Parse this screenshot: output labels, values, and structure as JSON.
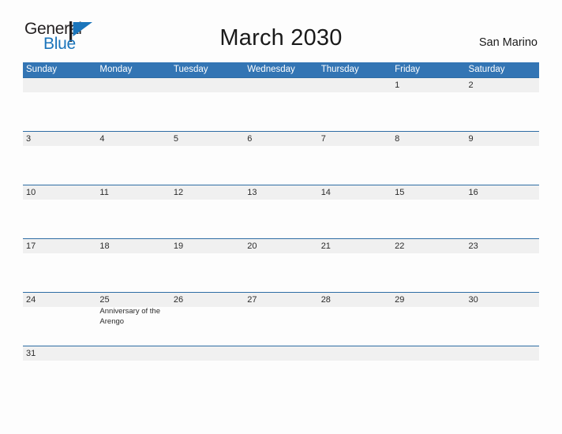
{
  "brand": {
    "name_part1": "General",
    "name_part2": "Blue",
    "mark": "triangle-flag-icon"
  },
  "header": {
    "title": "March 2030",
    "region": "San Marino"
  },
  "colors": {
    "header_blue": "#3375b4",
    "rule_blue": "#2e6da4",
    "band_gray": "#f0f0f0",
    "brand_blue": "#1b75bb",
    "text_dark": "#231f20"
  },
  "calendar": {
    "month": "March",
    "year": "2030",
    "day_headers": [
      "Sunday",
      "Monday",
      "Tuesday",
      "Wednesday",
      "Thursday",
      "Friday",
      "Saturday"
    ],
    "weeks": [
      [
        {
          "day": "",
          "event": ""
        },
        {
          "day": "",
          "event": ""
        },
        {
          "day": "",
          "event": ""
        },
        {
          "day": "",
          "event": ""
        },
        {
          "day": "",
          "event": ""
        },
        {
          "day": "1",
          "event": ""
        },
        {
          "day": "2",
          "event": ""
        }
      ],
      [
        {
          "day": "3",
          "event": ""
        },
        {
          "day": "4",
          "event": ""
        },
        {
          "day": "5",
          "event": ""
        },
        {
          "day": "6",
          "event": ""
        },
        {
          "day": "7",
          "event": ""
        },
        {
          "day": "8",
          "event": ""
        },
        {
          "day": "9",
          "event": ""
        }
      ],
      [
        {
          "day": "10",
          "event": ""
        },
        {
          "day": "11",
          "event": ""
        },
        {
          "day": "12",
          "event": ""
        },
        {
          "day": "13",
          "event": ""
        },
        {
          "day": "14",
          "event": ""
        },
        {
          "day": "15",
          "event": ""
        },
        {
          "day": "16",
          "event": ""
        }
      ],
      [
        {
          "day": "17",
          "event": ""
        },
        {
          "day": "18",
          "event": ""
        },
        {
          "day": "19",
          "event": ""
        },
        {
          "day": "20",
          "event": ""
        },
        {
          "day": "21",
          "event": ""
        },
        {
          "day": "22",
          "event": ""
        },
        {
          "day": "23",
          "event": ""
        }
      ],
      [
        {
          "day": "24",
          "event": ""
        },
        {
          "day": "25",
          "event": "Anniversary of the Arengo"
        },
        {
          "day": "26",
          "event": ""
        },
        {
          "day": "27",
          "event": ""
        },
        {
          "day": "28",
          "event": ""
        },
        {
          "day": "29",
          "event": ""
        },
        {
          "day": "30",
          "event": ""
        }
      ],
      [
        {
          "day": "31",
          "event": ""
        },
        {
          "day": "",
          "event": ""
        },
        {
          "day": "",
          "event": ""
        },
        {
          "day": "",
          "event": ""
        },
        {
          "day": "",
          "event": ""
        },
        {
          "day": "",
          "event": ""
        },
        {
          "day": "",
          "event": ""
        }
      ]
    ]
  }
}
